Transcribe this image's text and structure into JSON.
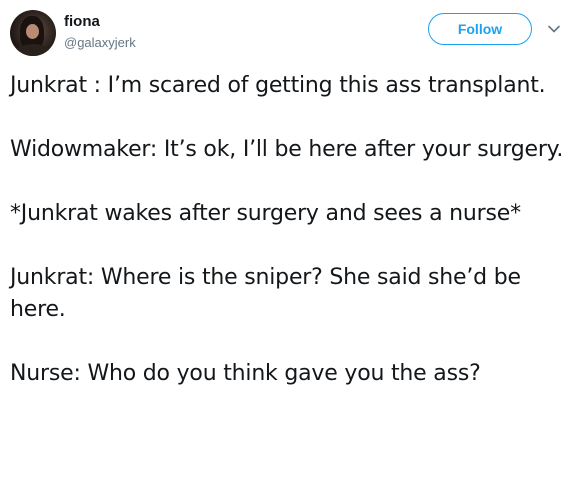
{
  "tweet": {
    "author": {
      "display_name": "fiona",
      "handle": "@galaxyjerk"
    },
    "follow_label": "Follow",
    "paragraphs": [
      "Junkrat : I’m scared of getting this ass transplant.",
      "Widowmaker: It’s ok, I’ll be here after your surgery.",
      "*Junkrat wakes after surgery and sees a nurse*",
      "Junkrat: Where is the sniper? She said she’d be here.",
      "Nurse: Who do you think gave you the ass?"
    ]
  },
  "icons": {
    "avatar": "profile-photo",
    "menu": "chevron-down-icon"
  },
  "colors": {
    "accent": "#1da1f2",
    "text": "#14171a",
    "secondary": "#657786"
  }
}
